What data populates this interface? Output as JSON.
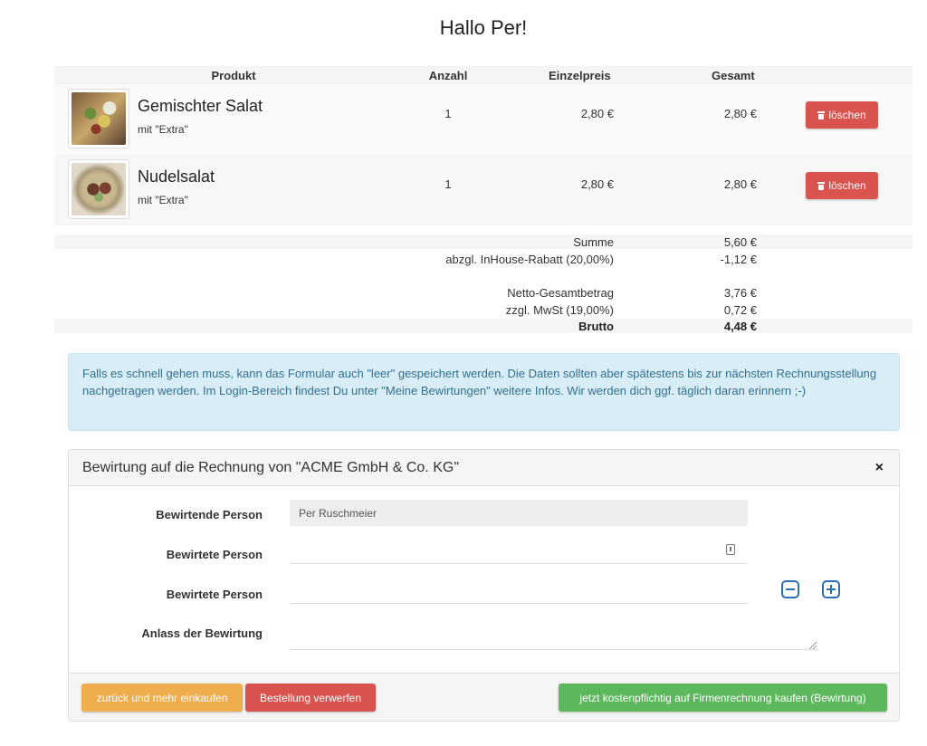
{
  "greeting": "Hallo Per!",
  "cart": {
    "headers": {
      "produkt": "Produkt",
      "anzahl": "Anzahl",
      "einzelpreis": "Einzelpreis",
      "gesamt": "Gesamt"
    },
    "items": [
      {
        "name": "Gemischter Salat",
        "extra": "mit \"Extra\"",
        "qty": "1",
        "unit_price": "2,80 €",
        "total": "2,80 €",
        "delete_label": "löschen"
      },
      {
        "name": "Nudelsalat",
        "extra": "mit \"Extra\"",
        "qty": "1",
        "unit_price": "2,80 €",
        "total": "2,80 €",
        "delete_label": "löschen"
      }
    ]
  },
  "summary": {
    "summe": {
      "label": "Summe",
      "value": "5,60 €"
    },
    "rabatt": {
      "label": "abzgl. InHouse-Rabatt (20,00%)",
      "value": "-1,12 €"
    },
    "netto": {
      "label": "Netto-Gesamtbetrag",
      "value": "3,76 €"
    },
    "mwst": {
      "label": "zzgl. MwSt (19,00%)",
      "value": "0,72 €"
    },
    "brutto": {
      "label": "Brutto",
      "value": "4,48 €"
    }
  },
  "info": "Falls es schnell gehen muss, kann das Formular auch \"leer\" gespeichert werden. Die Daten sollten aber spätestens bis zur nächsten Rechnungsstellung nachgetragen werden. Im Login-Bereich findest Du unter \"Meine Bewirtungen\" weitere Infos. Wir werden dich ggf. täglich daran erinnern ;-)",
  "panel": {
    "title": "Bewirtung auf die Rechnung von \"ACME GmbH & Co. KG\"",
    "close": "×",
    "fields": {
      "bewirtende_label": "Bewirtende Person",
      "bewirtende_value": "Per Ruschmeier",
      "bewirtete1_label": "Bewirtete Person",
      "bewirtete1_value": "",
      "bewirtete2_label": "Bewirtete Person",
      "bewirtete2_value": "",
      "anlass_label": "Anlass der Bewirtung",
      "anlass_value": ""
    },
    "buttons": {
      "back": "zurück und mehr einkaufen",
      "discard": "Bestellung verwerfen",
      "buy": "jetzt kostenpflichtig auf Firmenrechnung kaufen (Bewirtung)"
    }
  },
  "colors": {
    "danger": "#d9534f",
    "warning": "#f0ad4e",
    "success": "#5cb85c",
    "info_bg": "#d9edf7",
    "info_text": "#31708f",
    "primary": "#2a6fb5"
  }
}
